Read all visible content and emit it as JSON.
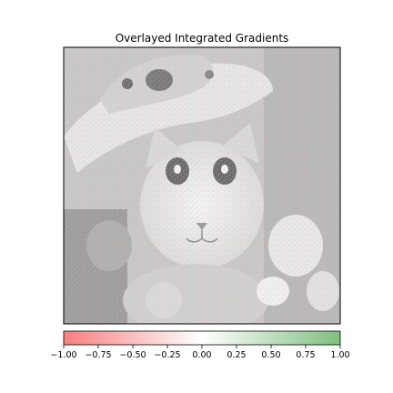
{
  "chart_data": {
    "type": "heatmap",
    "title": "Overlayed Integrated Gradients",
    "xlabel": "",
    "ylabel": "",
    "colorbar": {
      "orientation": "horizontal",
      "placement": "bottom",
      "range": [
        -1.0,
        1.0
      ],
      "ticks": [
        -1.0,
        -0.75,
        -0.5,
        -0.25,
        0.0,
        0.25,
        0.5,
        0.75,
        1.0
      ],
      "tick_labels": [
        "−1.00",
        "−0.75",
        "−0.50",
        "−0.25",
        "0.00",
        "0.25",
        "0.50",
        "0.75",
        "1.00"
      ],
      "colormap": [
        "#f77f7f",
        "#ffffff",
        "#7fbf7f"
      ]
    },
    "grid": false,
    "axes_ticks": false,
    "background_image": "grayscale photo of a kitten wearing a straw hat"
  },
  "colors": {
    "negative": "#f77f7f",
    "neutral": "#ffffff",
    "positive": "#7fbf7f",
    "frame": "#000000",
    "text": "#000000"
  }
}
